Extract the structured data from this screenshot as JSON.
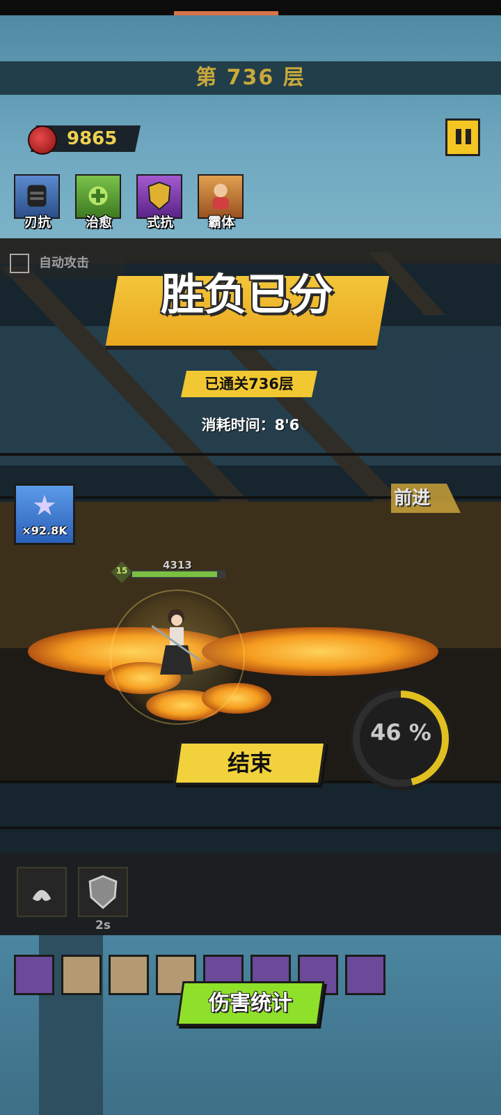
{
  "header": {
    "floor_title": "第 736 层"
  },
  "currency": {
    "value": "9865",
    "icon": "red-gem-icon"
  },
  "pause": {
    "icon": "pause-icon"
  },
  "buffs": [
    {
      "label": "刃抗",
      "icon": "helmet-icon",
      "color": "#3f6fb0"
    },
    {
      "label": "治愈",
      "icon": "heal-icon",
      "color": "#5da23a"
    },
    {
      "label": "式抗",
      "icon": "skill-shield-icon",
      "color": "#8a3db0"
    },
    {
      "label": "霸体",
      "icon": "brawler-icon",
      "color": "#c77a2a"
    }
  ],
  "auto_attack": {
    "label": "自动攻击",
    "checked": false
  },
  "result": {
    "title": "胜负已分",
    "cleared": "已通关736层",
    "time": "消耗时间：8'6"
  },
  "advance": {
    "label": "前进"
  },
  "medal": {
    "count": "×92.8K",
    "icon": "star-medal-icon"
  },
  "hero": {
    "level": "15",
    "hp": "4313",
    "hp_fraction": 0.95
  },
  "progress": {
    "value": 46,
    "label": "46 %",
    "color": "#e0c020"
  },
  "end_button": {
    "label": "结束"
  },
  "skills": [
    {
      "icon": "rage-fist-icon",
      "cooldown": ""
    },
    {
      "icon": "shield-icon",
      "cooldown": "2s"
    }
  ],
  "bottom_skills": [
    {
      "icon": "shadow-strike-icon"
    },
    {
      "icon": "explosion-icon"
    },
    {
      "icon": "lightning-icon"
    },
    {
      "icon": "thunder-slash-icon"
    },
    {
      "icon": "dark-shield-icon"
    },
    {
      "icon": "vortex-icon"
    },
    {
      "icon": "burst-icon"
    },
    {
      "icon": "meteor-icon"
    }
  ],
  "damage_stats": {
    "label": "伤害统计"
  }
}
